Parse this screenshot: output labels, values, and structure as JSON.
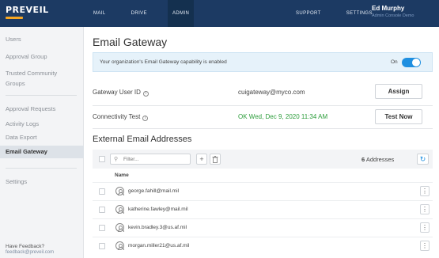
{
  "header": {
    "logo": "PREVEIL",
    "nav_left": [
      "MAIL",
      "DRIVE",
      "ADMIN"
    ],
    "nav_right": [
      "SUPPORT",
      "SETTINGS"
    ],
    "active_nav": "ADMIN",
    "user": {
      "name": "Ed Murphy",
      "role": "Admin Console Demo"
    }
  },
  "sidebar": {
    "items": [
      "Users",
      "Approval Group",
      "Trusted Community",
      "Groups",
      "Approval Requests",
      "Activity Logs",
      "Data Export",
      "Email Gateway",
      "Settings"
    ],
    "active": "Email Gateway",
    "feedback_title": "Have Feedback?",
    "feedback_link": "feedback@preveil.com"
  },
  "main": {
    "title": "Email Gateway",
    "banner": {
      "text": "Your organization's Email Gateway capability is enabled",
      "toggle_label": "On",
      "toggle_on": true
    },
    "gateway_user": {
      "label": "Gateway User ID",
      "value": "cuigateway@myco.com",
      "button": "Assign"
    },
    "connectivity": {
      "label": "Connectivity Test",
      "value": "OK Wed, Dec 9, 2020 11:34 AM",
      "button": "Test Now"
    },
    "external": {
      "title": "External Email Addresses",
      "filter_placeholder": "Filter...",
      "count": "6",
      "count_suffix": "Addresses",
      "column_name": "Name",
      "rows": [
        "george.fahill@mail.mil",
        "katherine.fawley@mail.mil",
        "kevin.bradley.3@us.af.mil",
        "morgan.miller21@us.af.mil"
      ]
    }
  },
  "colors": {
    "topbar": "#1c3a63",
    "accent": "#1f8fe0",
    "ok": "#2c9d3b",
    "logo_mark": "#f5a623"
  },
  "icons": {
    "info": "info-circle-icon",
    "filter": "filter-icon",
    "add": "plus-icon",
    "delete": "trash-icon",
    "refresh": "refresh-icon",
    "avatar": "user-circle-icon",
    "menu": "kebab-menu-icon"
  }
}
